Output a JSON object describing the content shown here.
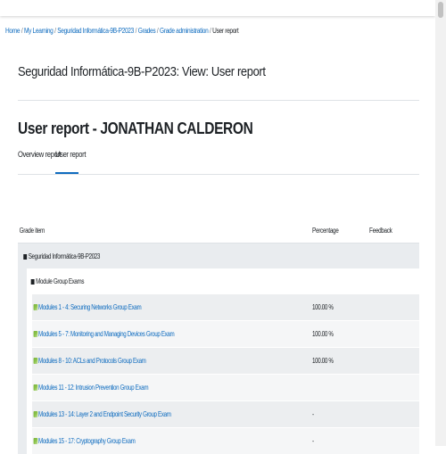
{
  "breadcrumb": [
    {
      "label": "Home"
    },
    {
      "label": "My Learning"
    },
    {
      "label": "Seguridad Informática-9B-P2023"
    },
    {
      "label": "Grades"
    },
    {
      "label": "Grade administration"
    },
    {
      "label": "User report"
    }
  ],
  "page_header": "Seguridad Informática-9B-P2023: View: User report",
  "report_title": "User report - JONATHAN CALDERON",
  "tabs": {
    "overview": "Overview report",
    "user": "User report"
  },
  "table": {
    "headers": {
      "grade_item": "Grade item",
      "percentage": "Percentage",
      "feedback": "Feedback"
    },
    "category": "Seguridad Informática-9B-P2023",
    "subcategory": "Module Group Exams",
    "items": [
      {
        "name": "Modules 1 - 4: Securing Networks Group Exam",
        "percentage": "100.00 %"
      },
      {
        "name": "Modules 5 - 7: Monitoring and Managing Devices Group Exam",
        "percentage": "100.00 %"
      },
      {
        "name": "Modules 8 - 10: ACLs and Protocols Group Exam",
        "percentage": "100.00 %"
      },
      {
        "name": "Modules 11 - 12: Intrusion Prevention Group Exam",
        "percentage": ""
      },
      {
        "name": "Modules 13 - 14: Layer 2 and Endpoint Security Group Exam",
        "percentage": "-"
      },
      {
        "name": "Modules 15 - 17: Cryptography Group Exam",
        "percentage": "-"
      }
    ]
  },
  "icons": {
    "category": "folder-icon",
    "item": "quiz-icon"
  },
  "colors": {
    "link": "#0f6cbf",
    "row_shade": "#e9ecef",
    "quiz_icon": "#8bc34a"
  }
}
